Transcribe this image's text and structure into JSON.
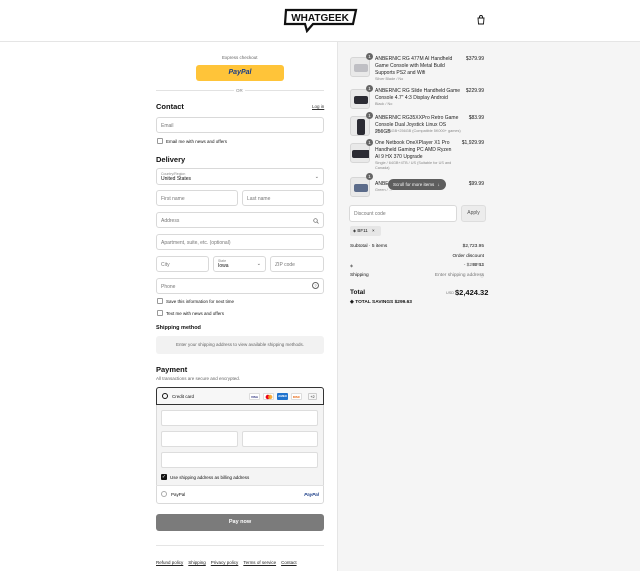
{
  "brand": {
    "name": "WHATGEEK"
  },
  "express": {
    "title": "Express checkout",
    "paypal_label": "PayPal",
    "or": "OR"
  },
  "contact": {
    "heading": "Contact",
    "login": "Log in",
    "email_placeholder": "Email",
    "email_news": "Email me with news and offers"
  },
  "delivery": {
    "heading": "Delivery",
    "country_label": "Country/Region",
    "country_value": "United States",
    "first_name": "First name",
    "last_name": "Last name",
    "address": "Address",
    "apartment": "Apartment, suite, etc. (optional)",
    "city": "City",
    "state_label": "State",
    "state_value": "Iowa",
    "zip": "ZIP code",
    "phone": "Phone",
    "save_info": "Save this information for next time",
    "text_me": "Text me with news and offers"
  },
  "shipping": {
    "heading": "Shipping method",
    "notice": "Enter your shipping address to view available shipping methods."
  },
  "payment": {
    "heading": "Payment",
    "subtitle": "All transactions are secure and encrypted.",
    "credit_card": "Credit card",
    "more_cards": "+2",
    "card_icons": [
      "VISA",
      "MC",
      "AMEX",
      "DISC"
    ],
    "billing": "Use shipping address as billing address",
    "paypal": "PayPal",
    "paypal_logo": "PayPal",
    "pay_button": "Pay now"
  },
  "footer_links": [
    "Refund policy",
    "Shipping",
    "Privacy policy",
    "Terms of service",
    "Contact"
  ],
  "items": [
    {
      "qty": "1",
      "name": "ANBERNIC RG 477M AI Handheld Game Console with Metal Build Supports PS2 and Wifi",
      "variant": "Silver Blade / No",
      "price": "$379.99"
    },
    {
      "qty": "1",
      "name": "ANBERNIC RG Slide Handheld Game Console 4.7\" 4:3 Display Android",
      "variant": "Black / No",
      "price": "$229.99"
    },
    {
      "qty": "1",
      "name": "ANBERNIC RG35XXPro Retro Game Console Dual Joystick Linux OS 256GB",
      "variant": "Black / 64GB+256GB (Compatible 5K000+ games)",
      "price": "$83.99"
    },
    {
      "qty": "1",
      "name": "One Netbook OneXPlayer X1 Pro Handheld Gaming PC AMD Ryzen AI 9 HX 370 Upgrade",
      "variant": "Single / 64GB+4TB / US (Suitable for US and Canada)",
      "price": "$1,929.99"
    },
    {
      "qty": "1",
      "name": "ANBERNIC ... ole",
      "variant": "Green / ...",
      "price": "$99.99"
    }
  ],
  "scroll_pill": "Scroll for more items",
  "discount": {
    "placeholder": "Discount code",
    "apply": "Apply",
    "tag": "BF11"
  },
  "summary": {
    "subtotal_label": "Subtotal · 5 items",
    "subtotal": "$2,723.95",
    "order_discount": "Order discount",
    "code": "BF11",
    "code_amount": "- $299.63",
    "shipping_label": "Shipping",
    "shipping_value": "Enter shipping address",
    "total_label": "Total",
    "currency": "USD",
    "total": "$2,424.32",
    "savings_label": "TOTAL SAVINGS",
    "savings": "$299.63"
  },
  "colors": {
    "paypal_yellow": "#ffc439",
    "pay_button": "#7b7b7b"
  }
}
